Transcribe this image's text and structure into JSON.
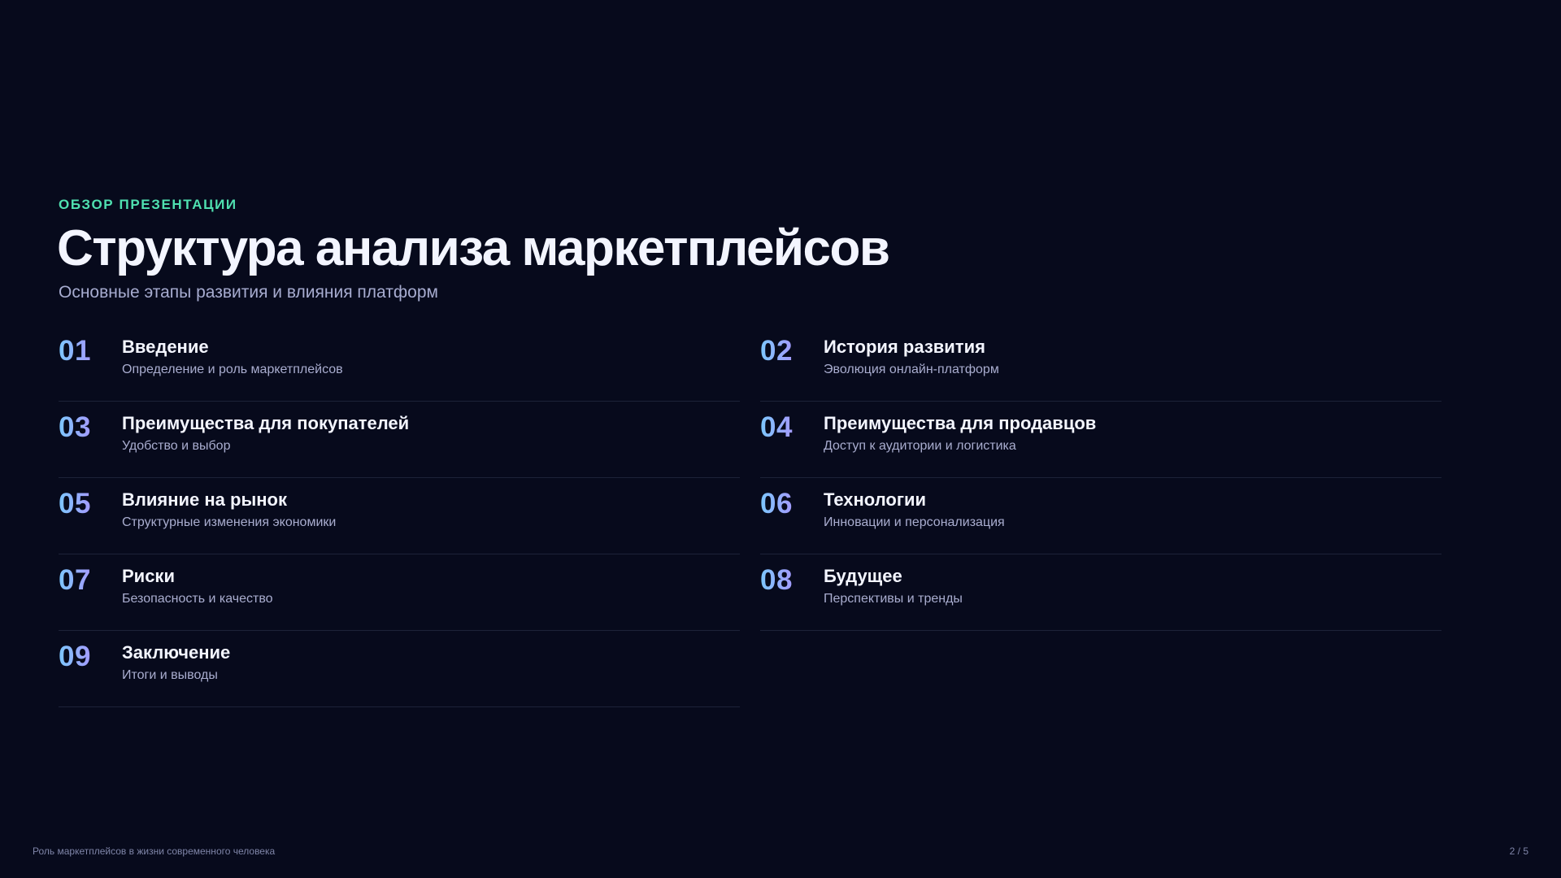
{
  "header": {
    "eyebrow": "ОБЗОР ПРЕЗЕНТАЦИИ",
    "title": "Структура анализа маркетплейсов",
    "subtitle": "Основные этапы развития и влияния платформ"
  },
  "items": [
    {
      "num": "01",
      "title": "Введение",
      "desc": "Определение и роль маркетплейсов"
    },
    {
      "num": "02",
      "title": "История развития",
      "desc": "Эволюция онлайн-платформ"
    },
    {
      "num": "03",
      "title": "Преимущества для покупателей",
      "desc": "Удобство и выбор"
    },
    {
      "num": "04",
      "title": "Преимущества для продавцов",
      "desc": "Доступ к аудитории и логистика"
    },
    {
      "num": "05",
      "title": "Влияние на рынок",
      "desc": "Структурные изменения экономики"
    },
    {
      "num": "06",
      "title": "Технологии",
      "desc": "Инновации и персонализация"
    },
    {
      "num": "07",
      "title": "Риски",
      "desc": "Безопасность и качество"
    },
    {
      "num": "08",
      "title": "Будущее",
      "desc": "Перспективы и тренды"
    },
    {
      "num": "09",
      "title": "Заключение",
      "desc": "Итоги и выводы"
    }
  ],
  "footer": {
    "caption": "Роль маркетплейсов в жизни современного человека",
    "page": "2 / 5"
  },
  "colors": {
    "background": "#070a1c",
    "accent": "#4fe0b0",
    "number_gradient_start": "#7cc7ff",
    "number_gradient_end": "#a49bff"
  }
}
